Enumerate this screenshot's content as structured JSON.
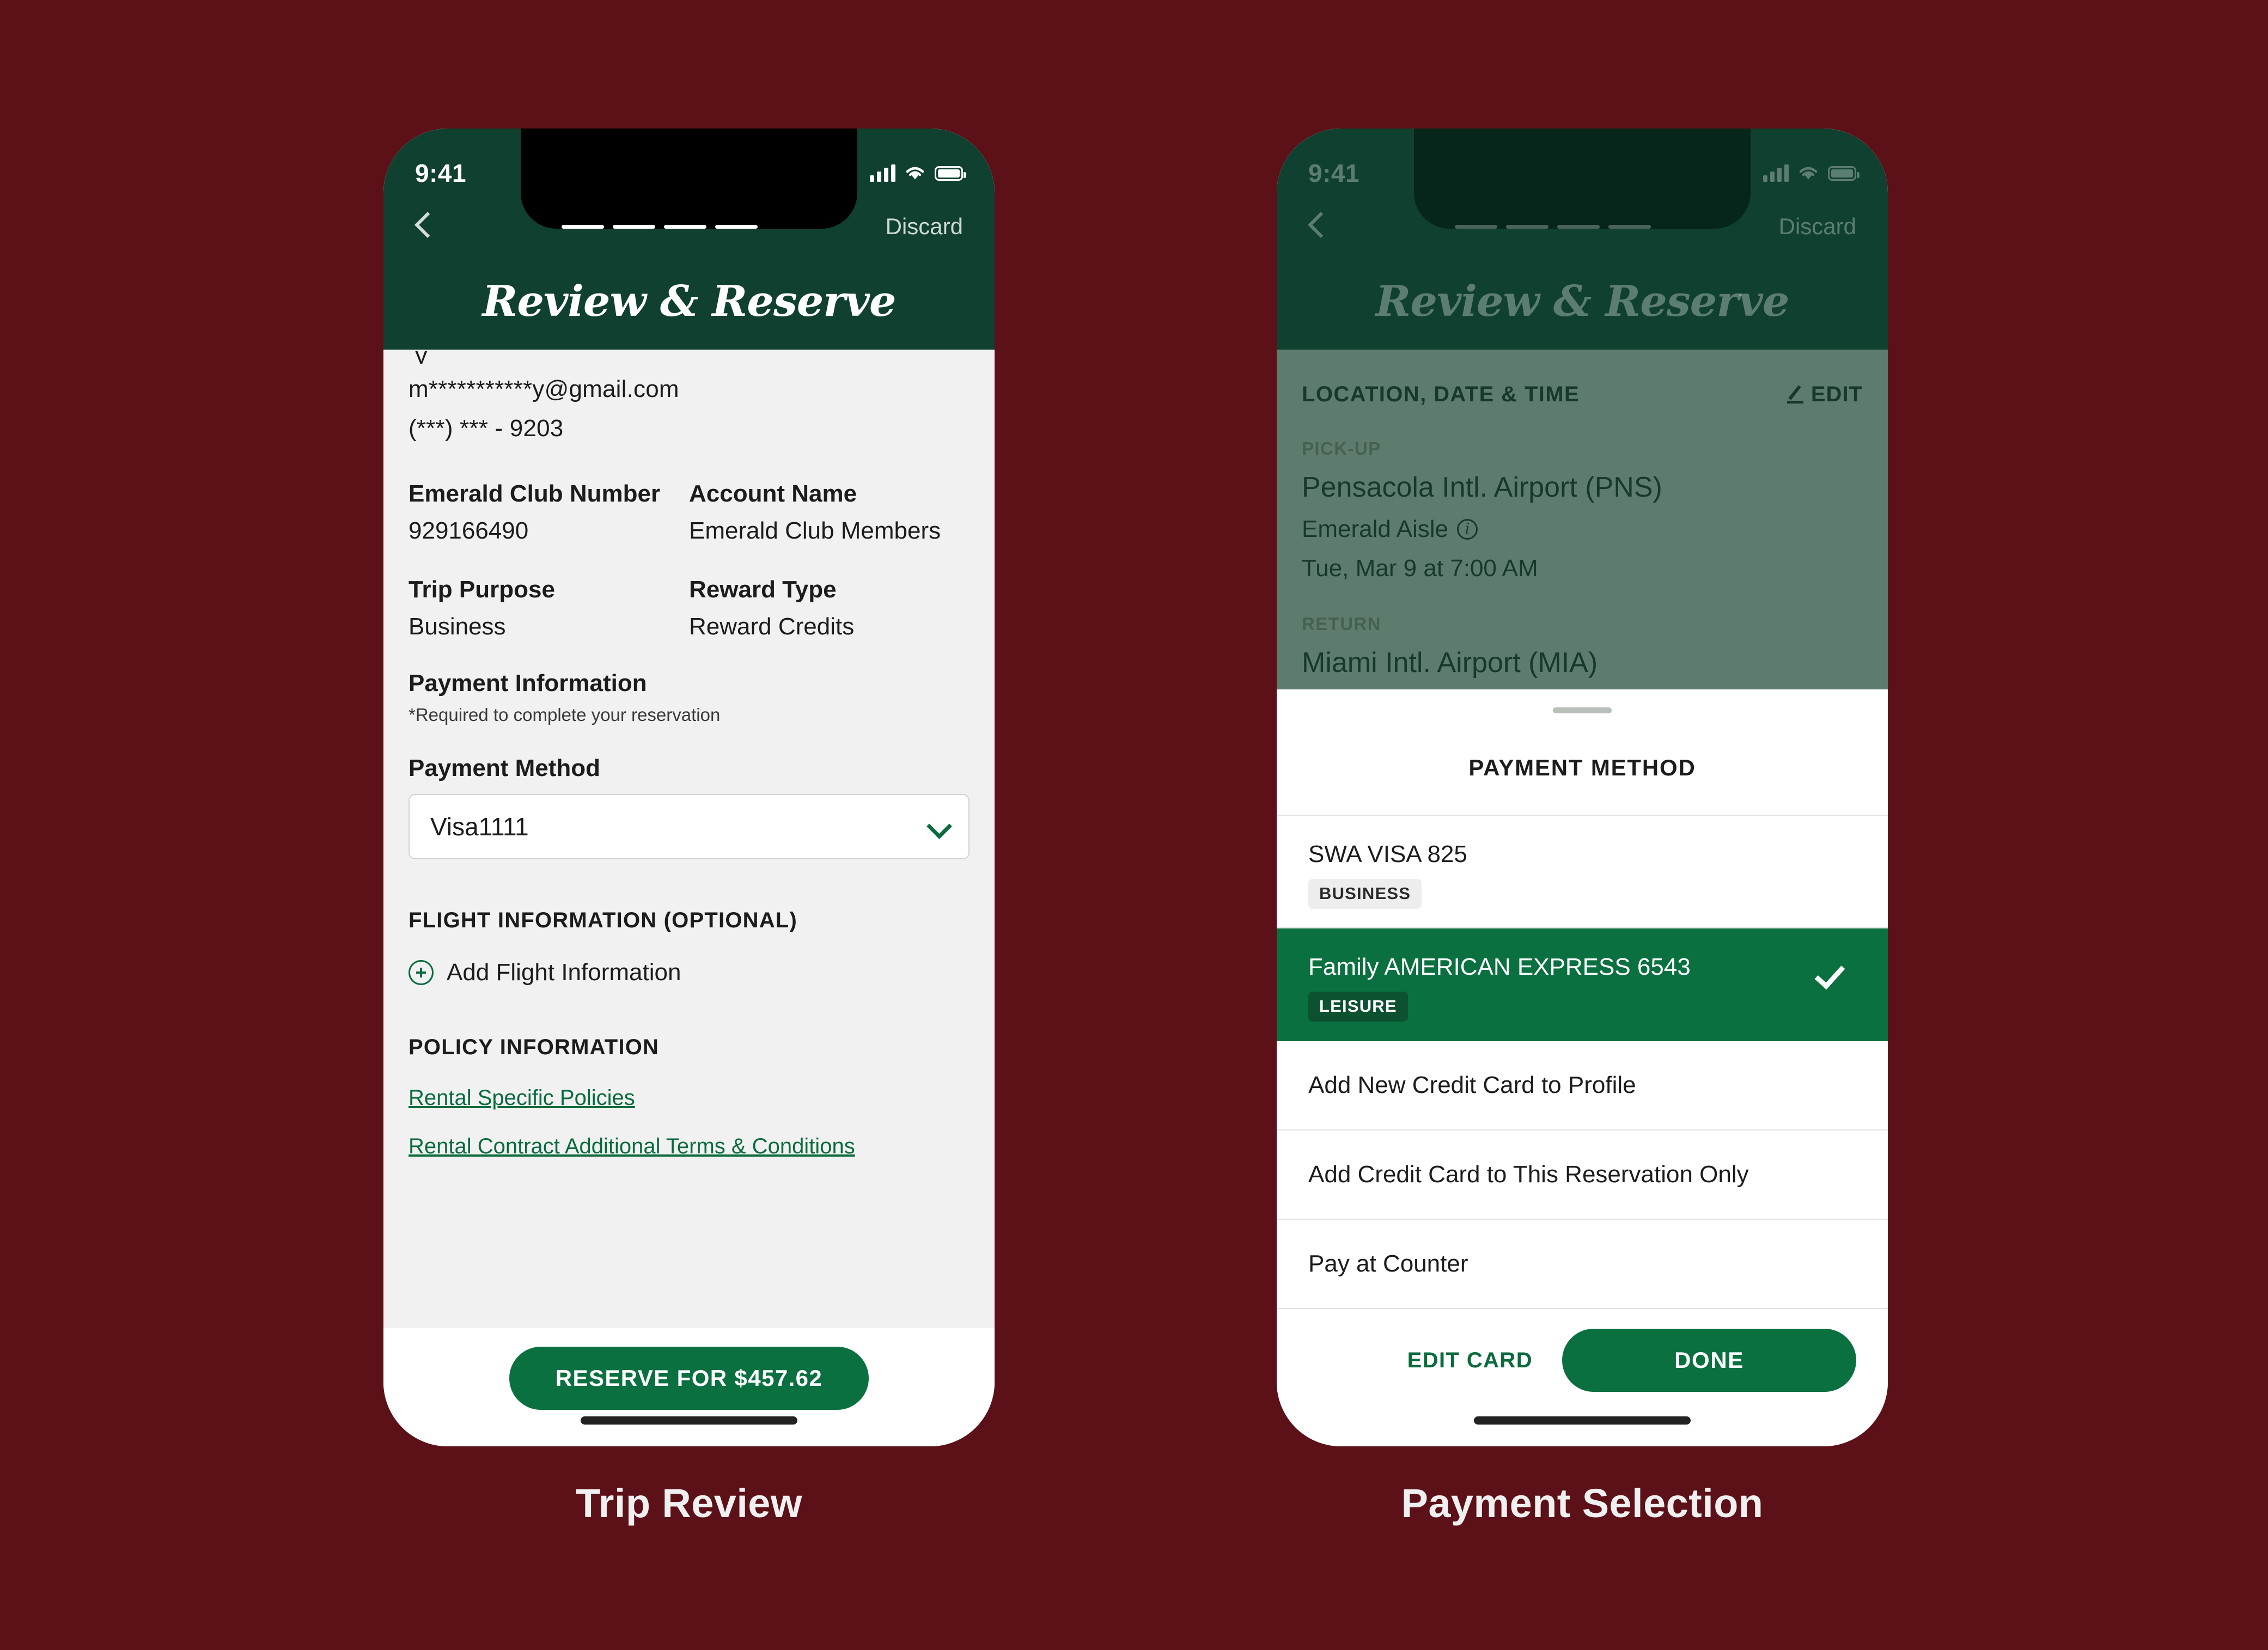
{
  "background_color": "#5C1018",
  "brand": {
    "header_green": "#10402F",
    "accent_green": "#0A7040",
    "link_green": "#0A6B3D"
  },
  "status_bar": {
    "time": "9:41",
    "signal_icon": "cellular-bars-icon",
    "wifi_icon": "wifi-icon",
    "battery_icon": "battery-icon"
  },
  "nav": {
    "back_icon": "back-chevron-icon",
    "discard_label": "Discard",
    "progress_steps": 4
  },
  "header": {
    "title": "Review & Reserve"
  },
  "trip_review": {
    "caption": "Trip Review",
    "contact": {
      "email": "m***********y@gmail.com",
      "phone": "(***) *** - 9203"
    },
    "fields": [
      {
        "label": "Emerald Club Number",
        "value": "929166490"
      },
      {
        "label": "Account Name",
        "value": "Emerald Club Members"
      },
      {
        "label": "Trip Purpose",
        "value": "Business"
      },
      {
        "label": "Reward Type",
        "value": "Reward Credits"
      }
    ],
    "payment_information": {
      "title": "Payment Information",
      "required_note": "*Required to complete your reservation",
      "method_label": "Payment Method",
      "method_value": "Visa1111",
      "chevron_icon": "chevron-down-icon"
    },
    "flight_information": {
      "heading": "FLIGHT INFORMATION (OPTIONAL)",
      "add_icon": "plus-circle-icon",
      "add_label": "Add Flight Information"
    },
    "policy_information": {
      "heading": "POLICY INFORMATION",
      "links": [
        "Rental Specific Policies",
        "Rental Contract Additional Terms & Conditions"
      ]
    },
    "reserve_button": "RESERVE FOR $457.62"
  },
  "payment_selection": {
    "caption": "Payment Selection",
    "backdrop": {
      "section_title": "LOCATION, DATE & TIME",
      "edit_label": "EDIT",
      "edit_icon": "pencil-icon",
      "pickup_kicker": "PICK-UP",
      "pickup_location": "Pensacola Intl. Airport (PNS)",
      "pickup_aisle": "Emerald Aisle",
      "info_icon": "info-circle-icon",
      "pickup_when": "Tue, Mar 9 at 7:00 AM",
      "return_kicker": "RETURN",
      "return_location": "Miami Intl. Airport (MIA)"
    },
    "sheet": {
      "grabber": "sheet-grabber",
      "title": "PAYMENT METHOD",
      "options": [
        {
          "label": "SWA VISA 825",
          "badge": "BUSINESS",
          "selected": false
        },
        {
          "label": "Family AMERICAN EXPRESS 6543",
          "badge": "LEISURE",
          "selected": true
        },
        {
          "label": "Add New Credit Card to Profile",
          "badge": null,
          "selected": false
        },
        {
          "label": "Add Credit Card to This Reservation Only",
          "badge": null,
          "selected": false
        },
        {
          "label": "Pay at Counter",
          "badge": null,
          "selected": false
        }
      ],
      "check_icon": "check-icon",
      "edit_card_label": "EDIT CARD",
      "done_label": "DONE"
    }
  }
}
